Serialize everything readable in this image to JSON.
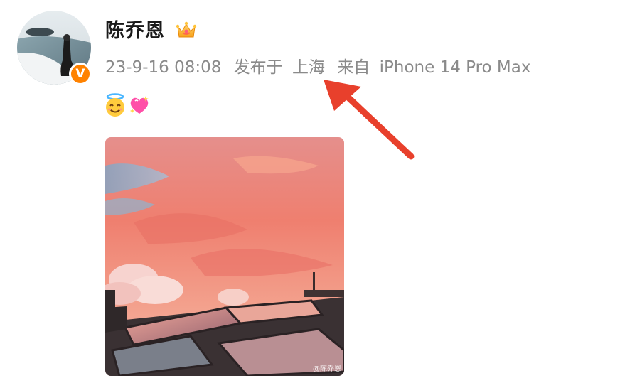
{
  "post": {
    "username": "陈乔恩",
    "badge_icon": "crown-icon",
    "verified_badge_letter": "V",
    "verified_badge_color": "#ff8200",
    "meta": {
      "datetime": "23-9-16 08:08",
      "published_prefix": "发布于",
      "location": "上海",
      "source_prefix": "来自",
      "device": "iPhone 14 Pro Max"
    },
    "emojis": [
      "smiling-face-with-halo-icon",
      "sparkling-heart-icon"
    ],
    "image": {
      "watermark": "@陈乔恩"
    },
    "annotation_color": "#e8402c"
  }
}
